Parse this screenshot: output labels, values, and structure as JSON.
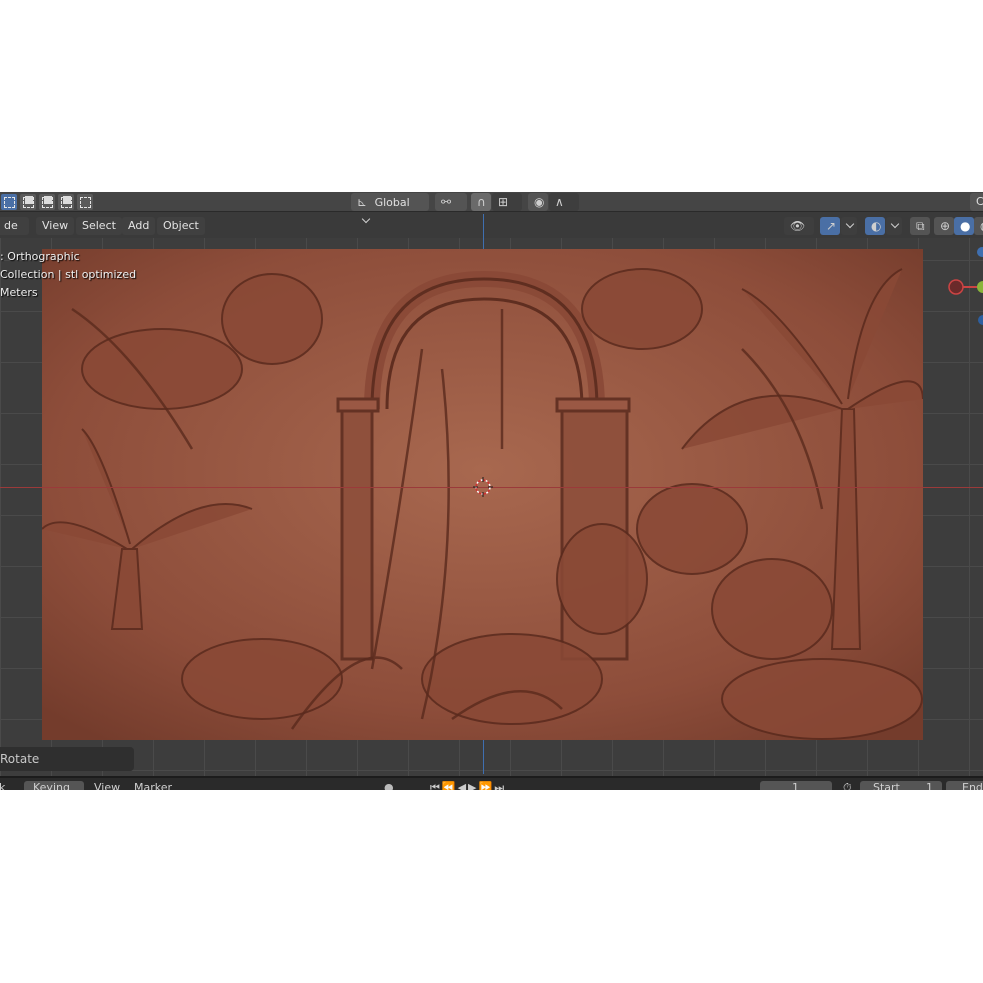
{
  "tool_header": {
    "transform_orientation": "Global",
    "right_edge_label": "C"
  },
  "view_header": {
    "mode_label": "de",
    "menu": [
      "View",
      "Select",
      "Add",
      "Object"
    ]
  },
  "viewport": {
    "overlay_lines": [
      ": Orthographic",
      "Collection | stl optimized",
      "Meters"
    ]
  },
  "operator_panel": {
    "label": "Rotate"
  },
  "timeline": {
    "items": [
      "k",
      "Keying",
      "View",
      "Marker"
    ],
    "current_frame": "1",
    "start_label": "Start",
    "start_value": "1",
    "end_label": "End"
  },
  "colors": {
    "axis_x": "#9b3a3a",
    "axis_y": "#3f6fb0",
    "relief": "#9a5a45",
    "active_tool": "#4a6fa5"
  },
  "icons": [
    "select-box-icon",
    "orientation-icon",
    "pivot-icon",
    "snap-icon",
    "proportional-edit-icon",
    "visibility-icon",
    "gizmo-toggle-icon",
    "overlay-icon",
    "xray-icon",
    "wireframe-shading-icon",
    "solid-shading-icon",
    "cursor-3d-icon"
  ]
}
